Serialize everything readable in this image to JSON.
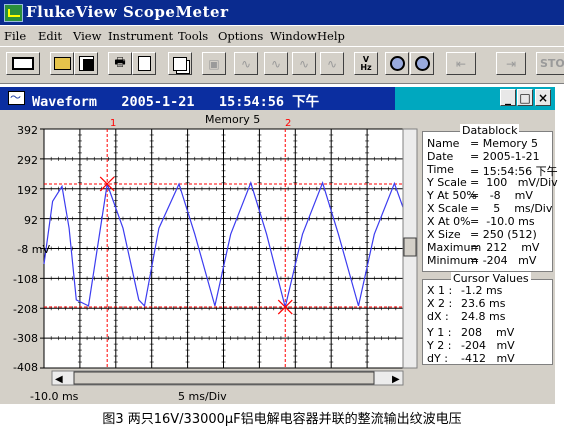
{
  "app": {
    "title": "FlukeView ScopeMeter"
  },
  "menu": [
    "File",
    "Edit",
    "View",
    "Instrument",
    "Tools",
    "Options",
    "Window",
    "Help"
  ],
  "toolbar": {
    "stop_label": "STO"
  },
  "waveform_window": {
    "title": "Waveform   2005-1-21   15:54:56 下午",
    "buttons": [
      "_",
      "□",
      "×"
    ]
  },
  "scope": {
    "memory_label": "Memory 5",
    "y_ticks": [
      "392",
      "292",
      "192",
      "92",
      "-8 mV",
      "-108",
      "-208",
      "-308",
      "-408"
    ],
    "x_start": "-10.0 ms",
    "x_unit": "5 ms/Div",
    "cursor_labels": [
      "1",
      "2"
    ],
    "trace_color": "#3c3cf0",
    "cursor_color": "#ff0000"
  },
  "chart_data": {
    "type": "line",
    "title": "Memory 5",
    "xlabel": "5 ms/Div",
    "ylabel": "mV",
    "xlim": [
      -10.0,
      40.0
    ],
    "ylim": [
      -408,
      392
    ],
    "x_unit": "ms",
    "y_unit": "mV",
    "series": [
      {
        "period_ms": 10.0,
        "maximum": 212,
        "minimum": -204,
        "points": [
          [
            -10.0,
            -60
          ],
          [
            -8.8,
            150
          ],
          [
            -7.5,
            200
          ],
          [
            -6.5,
            60
          ],
          [
            -5.5,
            -180
          ],
          [
            -3.8,
            -200
          ],
          [
            -1.2,
            208
          ],
          [
            1.0,
            60
          ],
          [
            3.2,
            -180
          ],
          [
            4.0,
            -200
          ],
          [
            6.0,
            60
          ],
          [
            8.8,
            208
          ],
          [
            11.0,
            40
          ],
          [
            13.8,
            -200
          ],
          [
            16.0,
            40
          ],
          [
            18.8,
            212
          ],
          [
            21.0,
            40
          ],
          [
            23.6,
            -204
          ],
          [
            26.0,
            40
          ],
          [
            28.8,
            212
          ],
          [
            31.0,
            40
          ],
          [
            33.8,
            -200
          ],
          [
            36.0,
            40
          ],
          [
            38.8,
            210
          ],
          [
            40.0,
            130
          ]
        ]
      }
    ],
    "cursors": [
      {
        "label": "1",
        "x": -1.2,
        "y": 208
      },
      {
        "label": "2",
        "x": 23.6,
        "y": -204
      }
    ]
  },
  "datablock": {
    "title": "Datablock",
    "rows": [
      [
        "Name",
        "= Memory 5"
      ],
      [
        "Date",
        "= 2005-1-21"
      ],
      [
        "Time",
        "= 15:54:56 下午"
      ],
      [
        "Y Scale",
        "=  100   mV/Div"
      ],
      [
        "Y At 50%",
        "=   -8    mV"
      ],
      [
        "X Scale",
        "=    5    ms/Div"
      ],
      [
        "X At 0%",
        "=  -10.0 ms"
      ],
      [
        "X Size",
        "= 250 (512)"
      ],
      [
        "Maximum",
        "=  212    mV"
      ],
      [
        "Minimum",
        "= -204   mV"
      ]
    ]
  },
  "cursor_values": {
    "title": "Cursor Values",
    "rows": [
      [
        "X 1 :",
        "-1.2 ms"
      ],
      [
        "X 2 :",
        "23.6 ms"
      ],
      [
        "dX :",
        "24.8 ms"
      ],
      [
        "Y 1 :",
        "208    mV"
      ],
      [
        "Y 2 :",
        "-204   mV"
      ],
      [
        "dY :",
        "-412   mV"
      ]
    ]
  },
  "caption": "图3 两只16V/33000μF铝电解电容器并联的整流输出纹波电压"
}
